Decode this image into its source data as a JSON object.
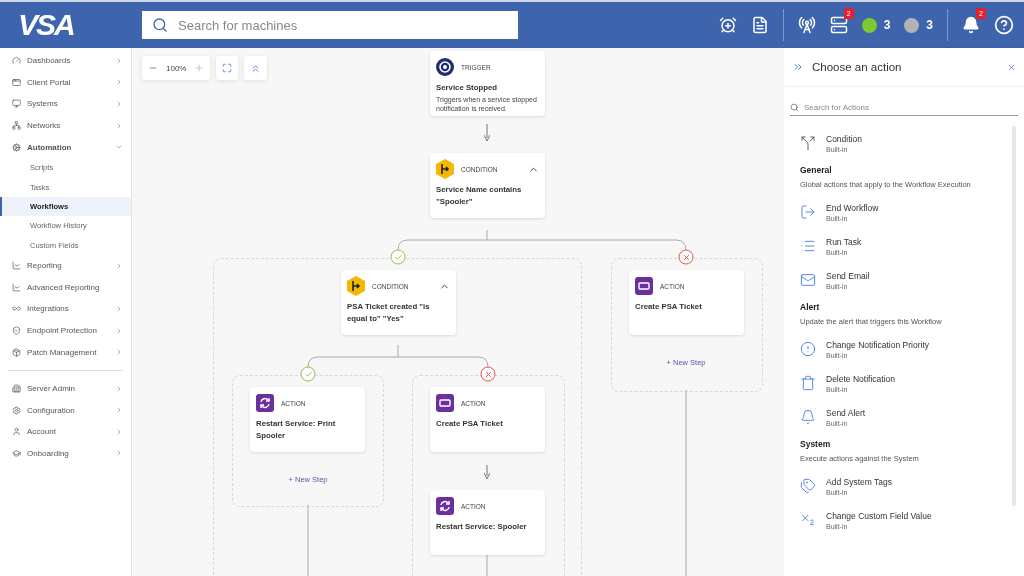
{
  "header": {
    "logo": "VSA",
    "search": {
      "placeholder": "Search for machines"
    },
    "badges": [
      {
        "kind": "servers",
        "count": "2"
      }
    ],
    "status": [
      {
        "color": "#7ec832",
        "count": "3"
      },
      {
        "color": "#b3b3b3",
        "count": "3"
      }
    ],
    "notifications": {
      "count": "2"
    }
  },
  "sidebar": {
    "groups": [
      [
        {
          "label": "Dashboards",
          "submenu": true,
          "expanded": false
        },
        {
          "label": "Client Portal",
          "submenu": true,
          "expanded": false
        },
        {
          "label": "Systems",
          "submenu": true,
          "expanded": false
        },
        {
          "label": "Networks",
          "submenu": true,
          "expanded": false
        },
        {
          "label": "Automation",
          "submenu": true,
          "expanded": true,
          "children": [
            {
              "label": "Scripts",
              "selected": false
            },
            {
              "label": "Tasks",
              "selected": false
            },
            {
              "label": "Workflows",
              "selected": true
            },
            {
              "label": "Workflow History",
              "selected": false
            },
            {
              "label": "Custom Fields",
              "selected": false
            }
          ]
        },
        {
          "label": "Reporting",
          "submenu": true,
          "expanded": false
        },
        {
          "label": "Advanced Reporting",
          "submenu": false,
          "expanded": false
        },
        {
          "label": "Integrations",
          "submenu": true,
          "expanded": false
        },
        {
          "label": "Endpoint Protection",
          "submenu": true,
          "expanded": false
        },
        {
          "label": "Patch Management",
          "submenu": true,
          "expanded": false
        }
      ],
      [
        {
          "label": "Server Admin",
          "submenu": true,
          "expanded": false
        },
        {
          "label": "Configuration",
          "submenu": true,
          "expanded": false
        },
        {
          "label": "Account",
          "submenu": true,
          "expanded": false
        },
        {
          "label": "Onboarding",
          "submenu": true,
          "expanded": false
        }
      ]
    ]
  },
  "canvas": {
    "zoom": "100%",
    "nodes": [
      {
        "kind": "trigger",
        "tag": "TRIGGER",
        "title": "Service Stopped",
        "description": "Triggers when a service stopped notification is received."
      },
      {
        "kind": "condition",
        "tag": "CONDITION",
        "title": "Service Name contains \"Spooler\"",
        "expanded": true
      },
      {
        "kind": "condition",
        "tag": "CONDITION",
        "title": "PSA Ticket created \"is equal to\" \"Yes\"",
        "expanded": true
      },
      {
        "kind": "action",
        "tag": "ACTION",
        "title": "Restart Service: Print Spooler"
      },
      {
        "kind": "action",
        "tag": "ACTION",
        "title": "Create PSA Ticket"
      },
      {
        "kind": "action",
        "tag": "ACTION",
        "title": "Restart Service: Spooler"
      },
      {
        "kind": "action",
        "tag": "ACTION",
        "title": "Create PSA Ticket"
      }
    ],
    "branches": [
      {
        "kind": "yes"
      },
      {
        "kind": "no"
      },
      {
        "kind": "yes"
      },
      {
        "kind": "no"
      }
    ],
    "new_steps": [
      "+ New Step",
      "+ New Step"
    ]
  },
  "panel": {
    "title": "Choose an action",
    "search": {
      "placeholder": "Search for Actions"
    },
    "items": [
      {
        "kind": "action",
        "title": "Condition",
        "subtitle": "Built-in"
      },
      {
        "kind": "section",
        "title": "General",
        "description": "Global actions that apply to the Workflow Execution"
      },
      {
        "kind": "action",
        "title": "End Workflow",
        "subtitle": "Built-in"
      },
      {
        "kind": "action",
        "title": "Run Task",
        "subtitle": "Built-in"
      },
      {
        "kind": "action",
        "title": "Send Email",
        "subtitle": "Built-in"
      },
      {
        "kind": "section",
        "title": "Alert",
        "description": "Update the alert that triggers this Workflow"
      },
      {
        "kind": "action",
        "title": "Change Notification Priority",
        "subtitle": "Built-in"
      },
      {
        "kind": "action",
        "title": "Delete Notification",
        "subtitle": "Built-in"
      },
      {
        "kind": "action",
        "title": "Send Alert",
        "subtitle": "Built-in"
      },
      {
        "kind": "section",
        "title": "System",
        "description": "Execute actions against the System"
      },
      {
        "kind": "action",
        "title": "Add System Tags",
        "subtitle": "Built-in"
      },
      {
        "kind": "action",
        "title": "Change Custom Field Value",
        "subtitle": "Built-in"
      }
    ]
  }
}
